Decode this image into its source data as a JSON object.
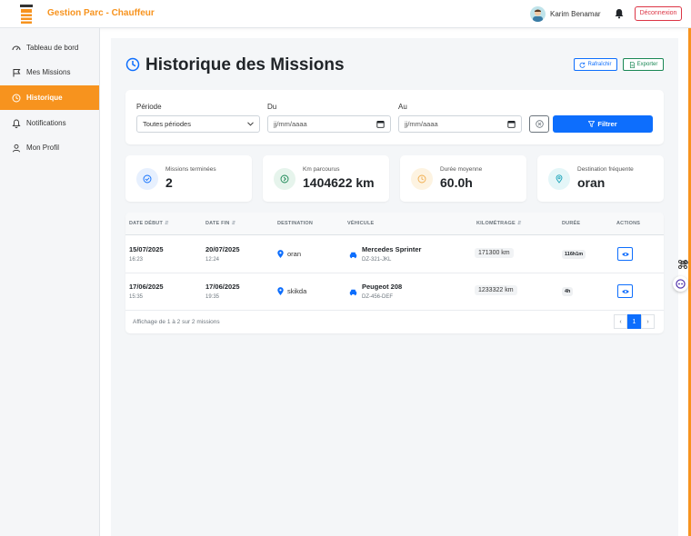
{
  "header": {
    "app_title": "Gestion Parc - Chauffeur",
    "user_name": "Karim Benamar",
    "logout_label": "Déconnexion"
  },
  "sidebar": {
    "items": [
      {
        "label": "Tableau de bord",
        "icon": "dashboard-gauge-icon",
        "active": false
      },
      {
        "label": "Mes Missions",
        "icon": "flag-icon",
        "active": false
      },
      {
        "label": "Historique",
        "icon": "clock-icon",
        "active": true
      },
      {
        "label": "Notifications",
        "icon": "bell-icon",
        "active": false
      },
      {
        "label": "Mon Profil",
        "icon": "user-icon",
        "active": false
      }
    ]
  },
  "page": {
    "title": "Historique des Missions",
    "refresh_label": "Rafraîchir",
    "export_label": "Exporter"
  },
  "filters": {
    "period_label": "Période",
    "period_value": "Toutes périodes",
    "from_label": "Du",
    "from_placeholder": "jj/mm/aaaa",
    "to_label": "Au",
    "to_placeholder": "jj/mm/aaaa",
    "filter_button": "Filtrer"
  },
  "stats": [
    {
      "label": "Missions terminées",
      "value": "2",
      "icon": "check-circle-icon",
      "color": "#0d6efd",
      "bg": "#e7f0fe"
    },
    {
      "label": "Km parcourus",
      "value": "1404622 km",
      "icon": "arrow-circle-icon",
      "color": "#198754",
      "bg": "#e6f4ec"
    },
    {
      "label": "Durée moyenne",
      "value": "60.0h",
      "icon": "clock-icon",
      "color": "#f0ad4e",
      "bg": "#fdf3e1"
    },
    {
      "label": "Destination fréquente",
      "value": "oran",
      "icon": "map-pin-icon",
      "color": "#17a2b8",
      "bg": "#e4f6f8"
    }
  ],
  "table": {
    "headers": {
      "date_debut": "Date début",
      "date_fin": "Date fin",
      "destination": "Destination",
      "vehicule": "Véhicule",
      "kilometrage": "Kilométrage",
      "duree": "Durée",
      "actions": "Actions"
    },
    "rows": [
      {
        "date_debut": "15/07/2025",
        "heure_debut": "16:23",
        "date_fin": "20/07/2025",
        "heure_fin": "12:24",
        "destination": "oran",
        "vehicule": "Mercedes Sprinter",
        "plaque": "DZ-321-JKL",
        "kilometrage": "171300 km",
        "duree": "116h1m"
      },
      {
        "date_debut": "17/06/2025",
        "heure_debut": "15:35",
        "date_fin": "17/06/2025",
        "heure_fin": "19:35",
        "destination": "skikda",
        "vehicule": "Peugeot 208",
        "plaque": "DZ-456-DEF",
        "kilometrage": "1233322 km",
        "duree": "4h"
      }
    ],
    "footer_text": "Affichage de 1 à 2 sur 2 missions",
    "pagination": {
      "prev": "‹",
      "current": "1",
      "next": "›"
    }
  }
}
